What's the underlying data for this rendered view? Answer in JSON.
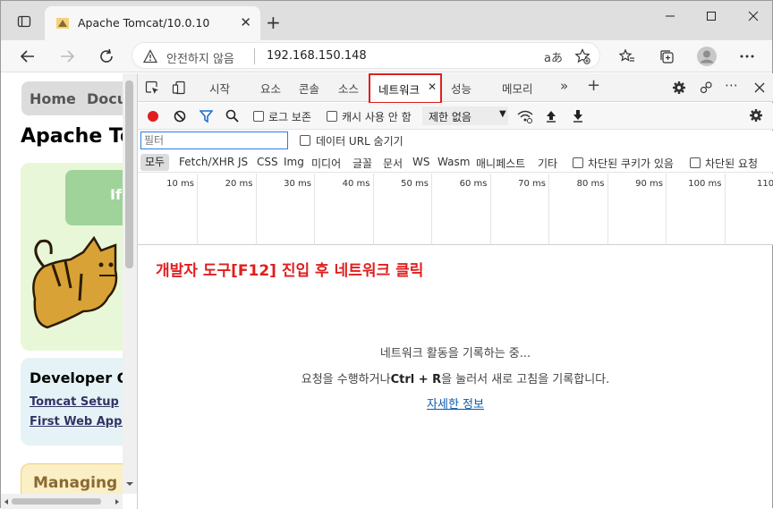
{
  "browser": {
    "tab_title": "Apache Tomcat/10.0.10",
    "security_label": "안전하지 않음",
    "url": "192.168.150.148",
    "read_aloud": "aあ"
  },
  "page": {
    "nav": [
      "Home",
      "Docu"
    ],
    "heading": "Apache To",
    "green_button": "If",
    "developer_heading": "Developer Q",
    "links": [
      "Tomcat Setup",
      "First Web Applic"
    ],
    "managing": "Managing T"
  },
  "devtools": {
    "tabs": [
      "시작",
      "요소",
      "콘솔",
      "소스",
      "성능",
      "메모리"
    ],
    "active_tab": "네트워크",
    "toolbar": {
      "preserve_log": "로그 보존",
      "disable_cache": "캐시 사용 안 함",
      "throttle": "제한 없음"
    },
    "filter_placeholder": "필터",
    "hide_data_urls": "데이터 URL 숨기기",
    "types": [
      "모두",
      "Fetch/XHR",
      "JS",
      "CSS",
      "Img",
      "미디어",
      "글꼴",
      "문서",
      "WS",
      "Wasm",
      "매니페스트",
      "기타"
    ],
    "blocked_cookies": "차단된 쿠키가 있음",
    "blocked_requests": "차단된 요청",
    "timeline_ticks": [
      "10 ms",
      "20 ms",
      "30 ms",
      "40 ms",
      "50 ms",
      "60 ms",
      "70 ms",
      "80 ms",
      "90 ms",
      "100 ms",
      "110 ms"
    ],
    "annotation": "개발자 도구[F12] 진입 후 네트워크 클릭",
    "recording_line1": "네트워크 활동을 기록하는 중...",
    "recording_line2_pre": "요청을 수행하거나",
    "recording_line2_key": "Ctrl + R",
    "recording_line2_post": "을 눌러서 새로 고침을 기록합니다.",
    "more_info": "자세한 정보"
  },
  "colors": {
    "highlight": "#e01e1e",
    "link": "#0b5cad"
  }
}
